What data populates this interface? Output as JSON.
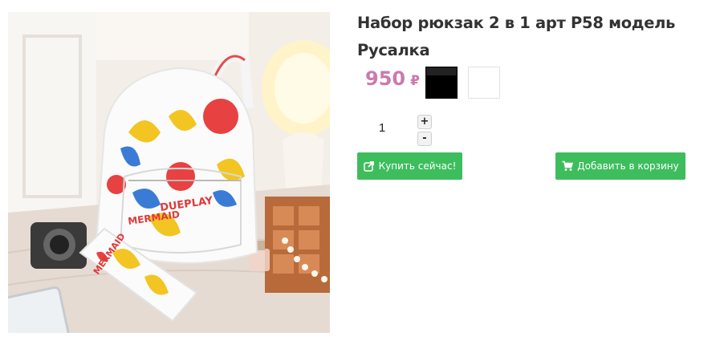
{
  "product": {
    "title": "Набор рюкзак 2 в 1 арт P58 модель Русалка",
    "price": "950",
    "currency": "₽",
    "image_alt": "backpack-photo",
    "swatches": [
      {
        "name": "black",
        "color": "#000000"
      },
      {
        "name": "white",
        "color": "#ffffff"
      }
    ]
  },
  "quantity": {
    "value": "1",
    "plus_label": "+",
    "minus_label": "-"
  },
  "actions": {
    "buy_now_label": "Купить сейчас!",
    "add_to_cart_label": "Добавить в корзину"
  },
  "photo_text": {
    "print_line1": "MERMAID",
    "print_line2": "DUEPLAY"
  },
  "colors": {
    "accent_green": "#3ebd5d",
    "price_pink": "#c97bb0"
  }
}
